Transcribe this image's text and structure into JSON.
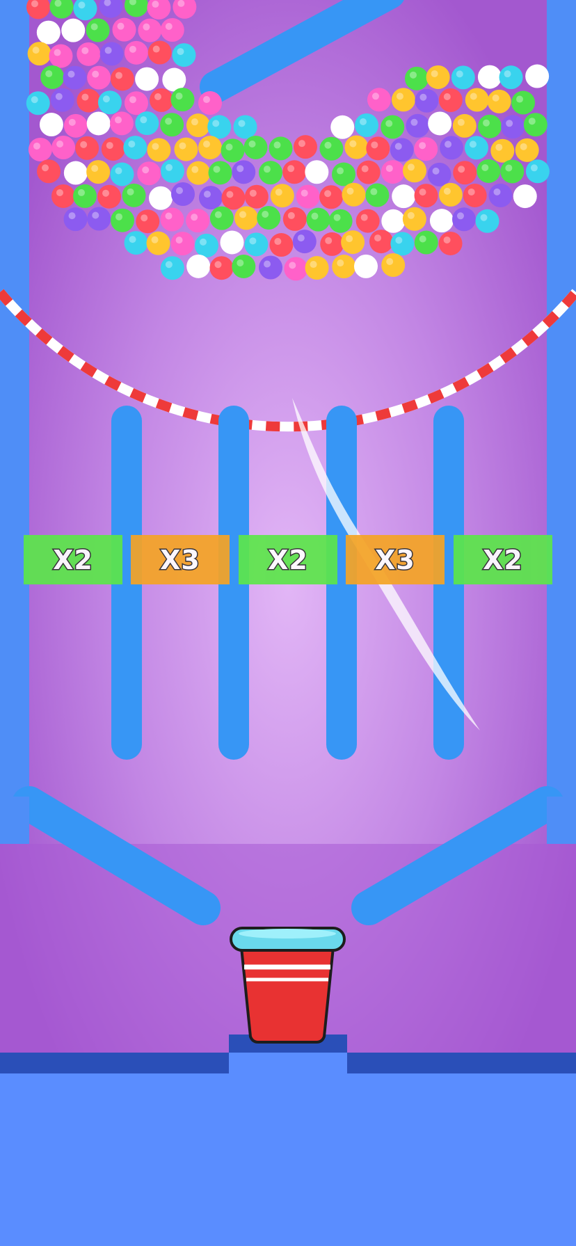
{
  "multipliers": [
    {
      "label": "X2",
      "color": "#5ce64a"
    },
    {
      "label": "X3",
      "color": "#f5a425"
    },
    {
      "label": "X2",
      "color": "#5ce64a"
    },
    {
      "label": "X3",
      "color": "#f5a425"
    },
    {
      "label": "X2",
      "color": "#5ce64a"
    }
  ],
  "colors": {
    "background": "#b469d8",
    "wall": "#4f8ef7",
    "pipe": "#3796f5",
    "floor": "#5a8dff",
    "floor_edge": "#2a4fb8",
    "cup": "#e83232",
    "cup_rim": "#6ad9ec",
    "ball_palette": [
      "#ff4f5e",
      "#ff61c9",
      "#ffc52e",
      "#4ce04a",
      "#39d3ee",
      "#8c5bf0",
      "#ffffff"
    ]
  },
  "icons": {
    "container": "dashed-bowl",
    "goal": "red-cup-icon"
  }
}
